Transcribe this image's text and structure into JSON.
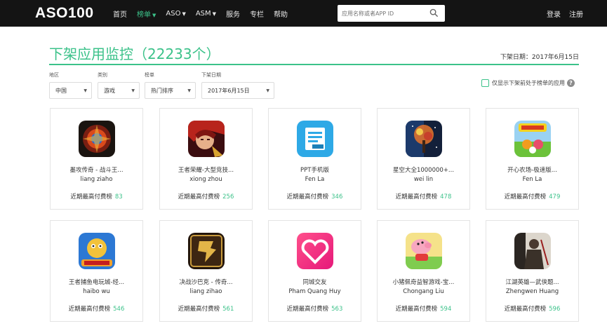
{
  "nav": {
    "logo": "ASO100",
    "menu": [
      {
        "label": "首页",
        "caret": false,
        "active": false
      },
      {
        "label": "榜单",
        "caret": true,
        "active": true
      },
      {
        "label": "ASO",
        "caret": true,
        "active": false
      },
      {
        "label": "ASM",
        "caret": true,
        "active": false
      },
      {
        "label": "服务",
        "caret": false,
        "active": false
      },
      {
        "label": "专栏",
        "caret": false,
        "active": false
      },
      {
        "label": "帮助",
        "caret": false,
        "active": false
      }
    ],
    "search_placeholder": "应用名称或者APP ID",
    "login": "登录",
    "register": "注册"
  },
  "page": {
    "title": "下架应用监控（22233个）",
    "update_date": "下架日期：2017年6月15日"
  },
  "filters": [
    {
      "label": "地区",
      "value": "中国"
    },
    {
      "label": "类别",
      "value": "游戏"
    },
    {
      "label": "榜单",
      "value": "热门排序"
    },
    {
      "label": "下架日期",
      "value": "2017年6月15日"
    }
  ],
  "checkbox_label": "仅显示下架前处于榜单的应用",
  "days_label": "近期最高付费榜",
  "apps": [
    {
      "name": "墨攻传奇 - 战斗王...",
      "developer": "liang ziaho",
      "days": "83",
      "icon": "fantasy-game-icon"
    },
    {
      "name": "王者荣耀-大型竞技...",
      "developer": "xiong zhou",
      "days": "256",
      "icon": "warrior-game-icon"
    },
    {
      "name": "PPT手机版",
      "developer": "Fen La",
      "days": "346",
      "icon": "ppt-app-icon"
    },
    {
      "name": "星空大全1000000+...",
      "developer": "wei lin",
      "days": "478",
      "icon": "starry-tree-icon"
    },
    {
      "name": "开心农场-极速版...",
      "developer": "Fen La",
      "days": "479",
      "icon": "farm-game-icon"
    },
    {
      "name": "王者捕鱼电玩城-经...",
      "developer": "haibo wu",
      "days": "546",
      "icon": "fishing-game-icon"
    },
    {
      "name": "决战沙巴克 - 传奇...",
      "developer": "liang zihao",
      "days": "561",
      "icon": "legend-game-icon"
    },
    {
      "name": "同城交友",
      "developer": "Pham Quang Huy",
      "days": "563",
      "icon": "heart-app-icon"
    },
    {
      "name": "小猪佩奇益智游戏-宝...",
      "developer": "Chongang Liu",
      "days": "594",
      "icon": "peppa-pig-icon"
    },
    {
      "name": "江湖英雄—武侠题...",
      "developer": "Zhengwen Huang",
      "days": "596",
      "icon": "wuxia-game-icon"
    }
  ]
}
